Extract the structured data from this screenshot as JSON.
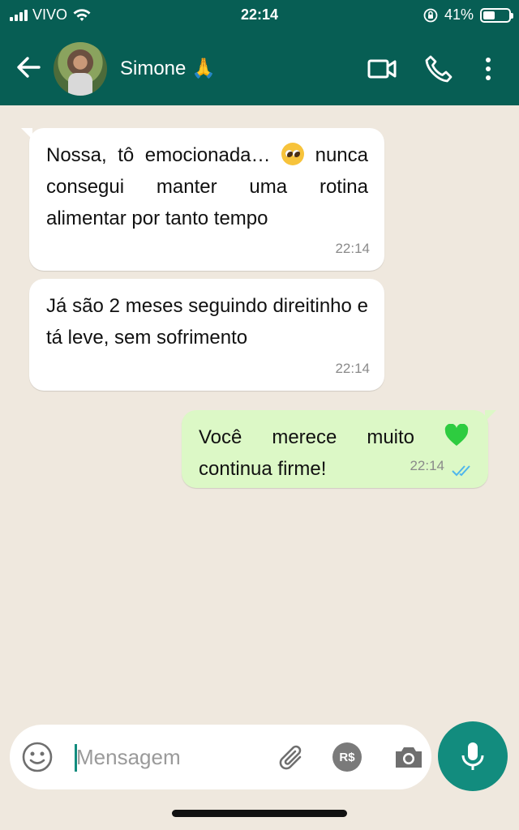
{
  "status_bar": {
    "carrier": "VIVO",
    "time": "22:14",
    "battery": "41%",
    "battery_level": 0.41
  },
  "header": {
    "contact_name": "Simone 🙏",
    "icons": [
      "back-arrow-icon",
      "video-call-icon",
      "voice-call-icon",
      "more-options-icon"
    ]
  },
  "messages": [
    {
      "direction": "incoming",
      "text_before_emoji": "Nossa, tô emocionada… ",
      "text_after_emoji": " nunca consegui manter uma rotina alimentar por tanto tempo",
      "emoji": "pleading-face-emoji",
      "time": "22:14"
    },
    {
      "direction": "incoming",
      "text": "Já são 2 meses seguindo direitinho e tá leve, sem sofrimento",
      "time": "22:14"
    },
    {
      "direction": "outgoing",
      "text_before_emoji": "Você merece muito ",
      "text_after_emoji": " continua firme!",
      "emoji": "green-heart-emoji",
      "time": "22:14",
      "read_receipt": "double-check-read"
    }
  ],
  "composer": {
    "placeholder": "Mensagem",
    "value": "",
    "payment_label": "R$",
    "icons": [
      "emoji-icon",
      "attach-icon",
      "payment-icon",
      "camera-icon",
      "microphone-icon"
    ]
  },
  "colors": {
    "header_green": "#075e54",
    "outgoing_bubble": "#dcf8c6",
    "incoming_bubble": "#ffffff",
    "chat_background": "#efe8de",
    "accent": "#128c7e",
    "read_tick": "#4fb6ec"
  }
}
